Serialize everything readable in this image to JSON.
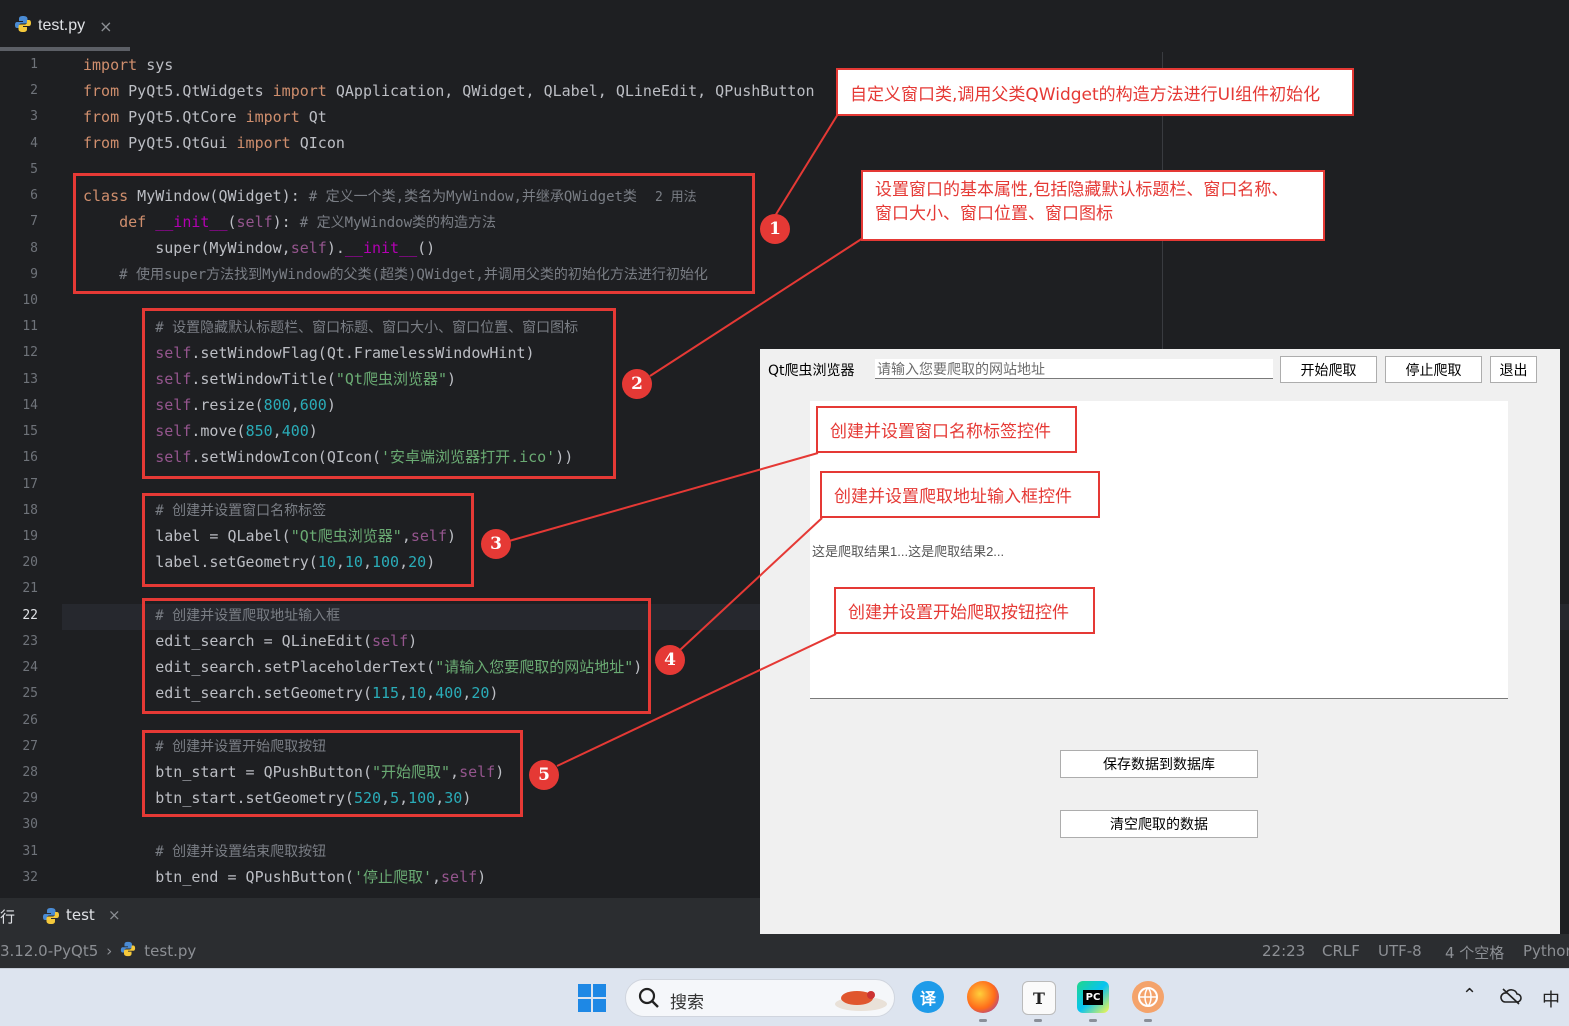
{
  "tab": {
    "filename": "test.py",
    "close": "×"
  },
  "code": {
    "lines": [
      "1",
      "2",
      "3",
      "4",
      "5",
      "6",
      "7",
      "8",
      "9",
      "10",
      "11",
      "12",
      "13",
      "14",
      "15",
      "16",
      "17",
      "18",
      "19",
      "20",
      "21",
      "22",
      "23",
      "24",
      "25",
      "26",
      "27",
      "28",
      "29",
      "30",
      "31",
      "32"
    ],
    "current_line": "22",
    "usage_hint": "2 用法"
  },
  "annotations": {
    "callout1": "自定义窗口类,调用父类QWidget的构造方法进行UI组件初始化",
    "callout2_line1": "设置窗口的基本属性,包括隐藏默认标题栏、窗口名称、",
    "callout2_line2": "窗口大小、窗口位置、窗口图标",
    "callout3": "创建并设置窗口名称标签控件",
    "callout4": "创建并设置爬取地址输入框控件",
    "callout5": "创建并设置开始爬取按钮控件",
    "badges": [
      "1",
      "2",
      "3",
      "4",
      "5"
    ]
  },
  "app": {
    "title_label": "Qt爬虫浏览器",
    "search_placeholder": "请输入您要爬取的网站地址",
    "start_button": "开始爬取",
    "stop_button": "停止爬取",
    "exit_button": "退出",
    "result_text": "这是爬取结果1...这是爬取结果2...",
    "save_button": "保存数据到数据库",
    "clear_button": "清空爬取的数据"
  },
  "run_panel": {
    "left_char": "行",
    "tab_label": "test",
    "close": "×"
  },
  "status": {
    "interpreter": "3.12.0-PyQt5",
    "file": "test.py",
    "position": "22:23",
    "line_sep": "CRLF",
    "encoding": "UTF-8",
    "indent": "4 个空格",
    "lang": "Python"
  },
  "taskbar": {
    "search_placeholder": "搜索",
    "ime": "中"
  },
  "colors": {
    "annotation_red": "#e53935",
    "editor_bg": "#1e1f22"
  }
}
